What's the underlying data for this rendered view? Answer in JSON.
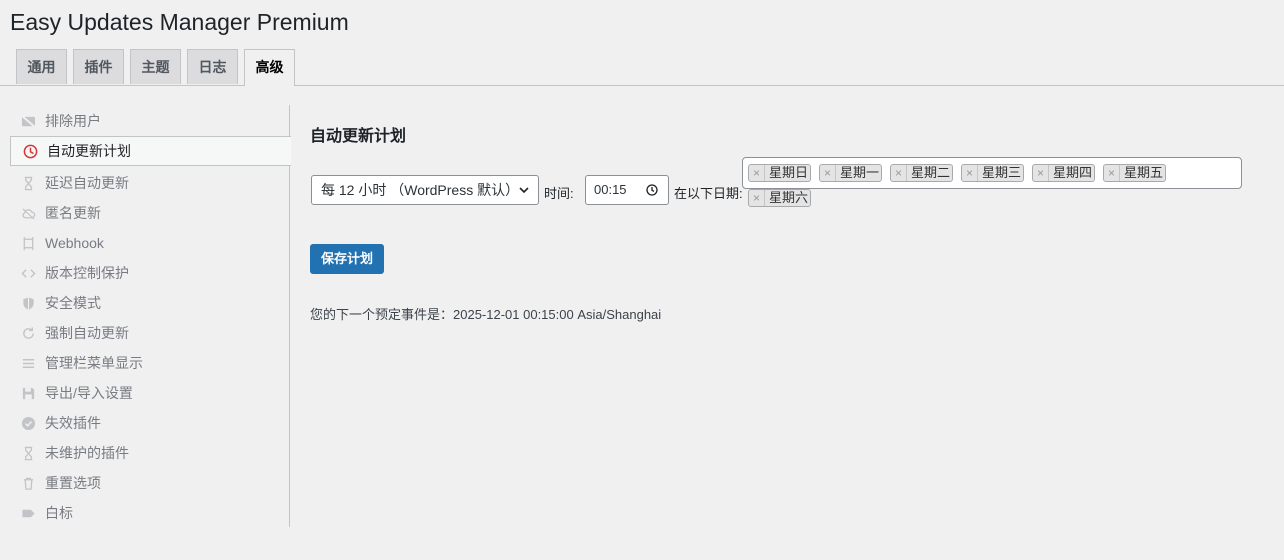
{
  "title": "Easy Updates Manager Premium",
  "tabs": [
    {
      "label": "通用"
    },
    {
      "label": "插件"
    },
    {
      "label": "主题"
    },
    {
      "label": "日志"
    },
    {
      "label": "高级",
      "active": true
    }
  ],
  "sidebar": {
    "items": [
      {
        "label": "排除用户",
        "icon": "user-excluded-icon"
      },
      {
        "label": "自动更新计划",
        "icon": "clock-icon",
        "active": true
      },
      {
        "label": "延迟自动更新",
        "icon": "hourglass-icon"
      },
      {
        "label": "匿名更新",
        "icon": "cloud-icon"
      },
      {
        "label": "Webhook",
        "icon": "webhook-icon"
      },
      {
        "label": "版本控制保护",
        "icon": "code-icon"
      },
      {
        "label": "安全模式",
        "icon": "shield-icon"
      },
      {
        "label": "强制自动更新",
        "icon": "refresh-icon"
      },
      {
        "label": "管理栏菜单显示",
        "icon": "menu-icon"
      },
      {
        "label": "导出/导入设置",
        "icon": "save-icon"
      },
      {
        "label": "失效插件",
        "icon": "check-circle-icon"
      },
      {
        "label": "未维护的插件",
        "icon": "hourglass-icon"
      },
      {
        "label": "重置选项",
        "icon": "trash-icon"
      },
      {
        "label": "白标",
        "icon": "tag-icon"
      }
    ]
  },
  "main": {
    "section_title": "自动更新计划",
    "frequency_value": "每 12 小时 （WordPress 默认）",
    "time_label": "时间:",
    "time_value": "00:15",
    "days_label": "在以下日期:",
    "days": [
      "星期日",
      "星期一",
      "星期二",
      "星期三",
      "星期四",
      "星期五",
      "星期六"
    ],
    "save_label": "保存计划",
    "next_event_text": "您的下一个预定事件是：2025-12-01 00:15:00 Asia/Shanghai"
  },
  "colors": {
    "accent": "#2271b1",
    "active_icon": "#d63638",
    "background": "#f0f0f1"
  }
}
